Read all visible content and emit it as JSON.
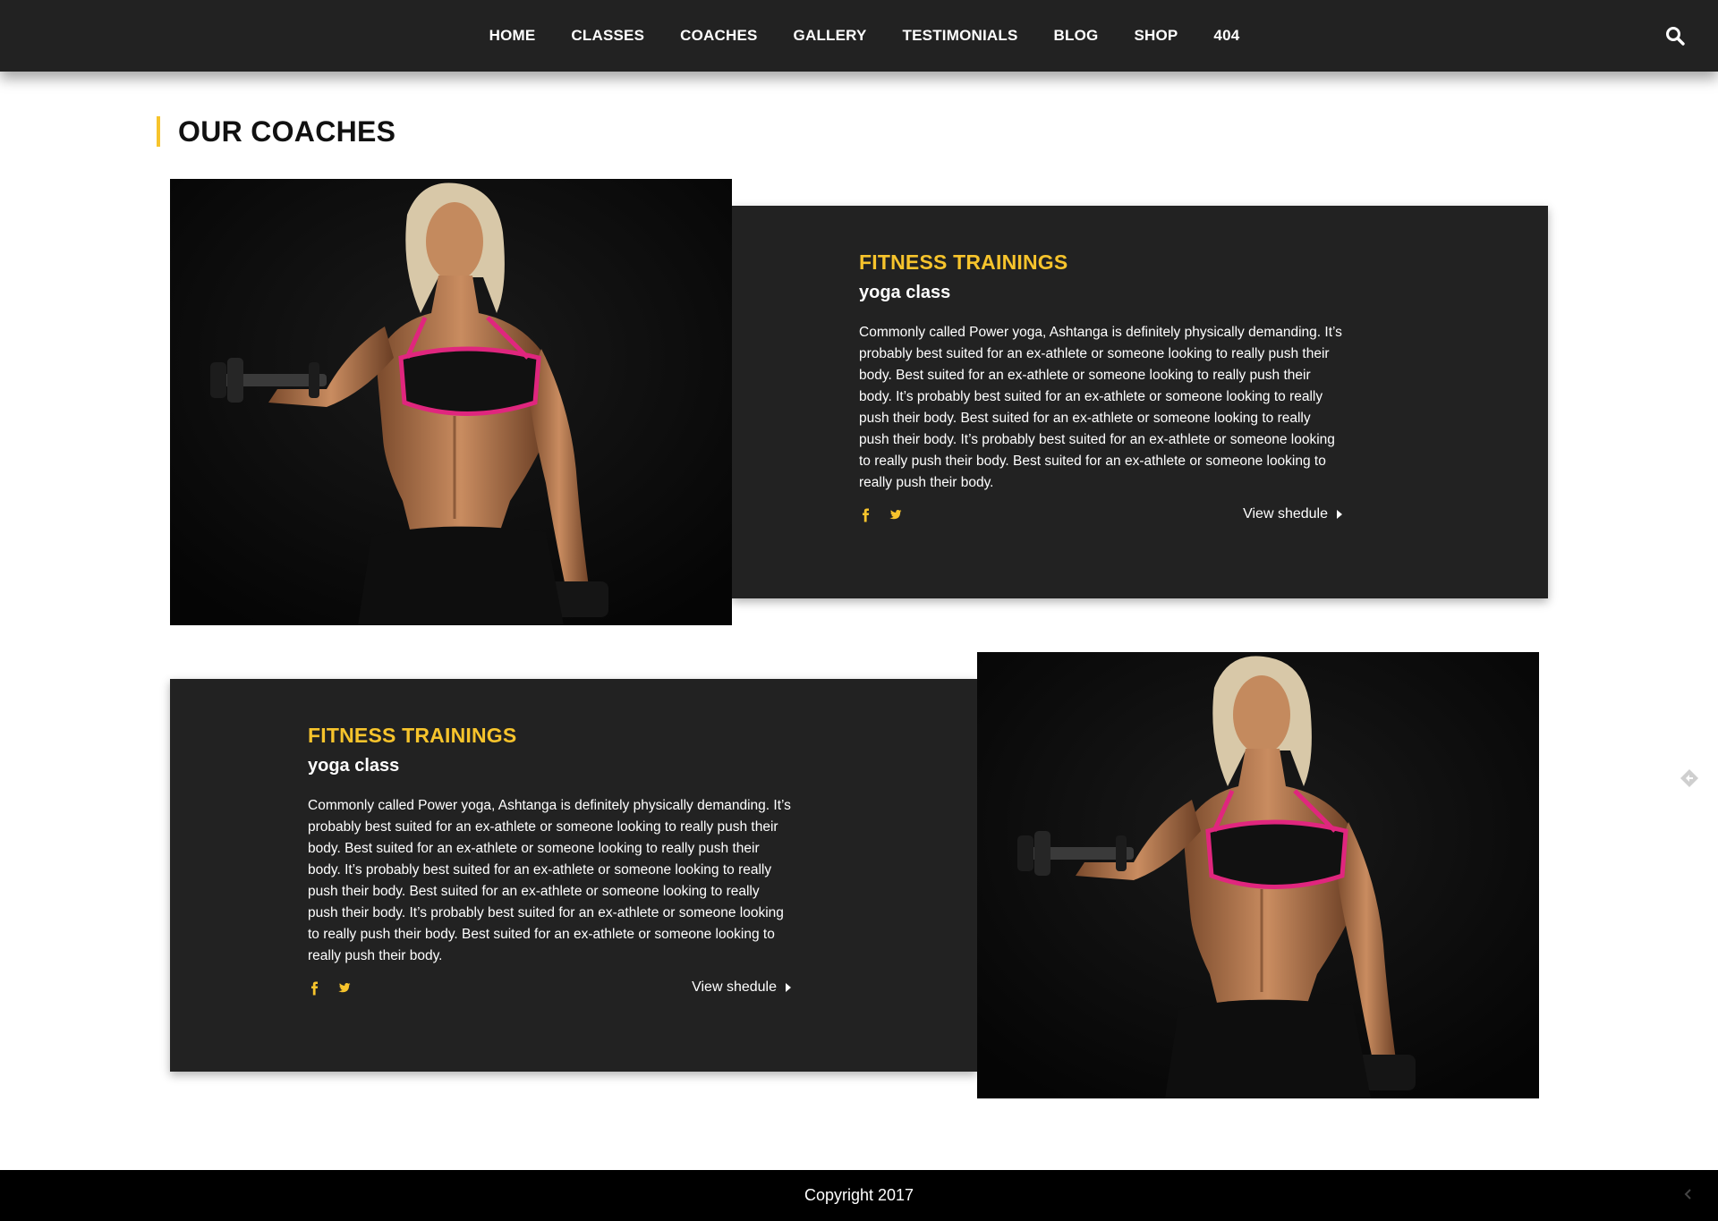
{
  "nav": {
    "items": [
      "HOME",
      "CLASSES",
      "COACHES",
      "GALLERY",
      "TESTIMONIALS",
      "BLOG",
      "SHOP",
      "404"
    ],
    "search_icon": "search-icon"
  },
  "section": {
    "title": "OUR COACHES"
  },
  "coaches": [
    {
      "title": "FITNESS TRAININGS",
      "subtitle": "yoga class",
      "description": "Commonly called Power yoga, Ashtanga is definitely physically demanding. It’s probably best suited for an ex-athlete or someone looking to really push their body. Best suited for an ex-athlete or someone looking to really push their body. It’s probably best suited for an ex-athlete or someone looking to really push their body. Best suited for an ex-athlete or someone looking to really push their body. It’s probably best suited for an ex-athlete or someone looking to really push their body. Best suited for an ex-athlete or someone looking to really push their body.",
      "schedule_label": "View shedule",
      "social": [
        "facebook-icon",
        "twitter-icon"
      ]
    },
    {
      "title": "FITNESS TRAININGS",
      "subtitle": "yoga class",
      "description": "Commonly called Power yoga, Ashtanga is definitely physically demanding. It’s probably best suited for an ex-athlete or someone looking to really push their body. Best suited for an ex-athlete or someone looking to really push their body. It’s probably best suited for an ex-athlete or someone looking to really push their body. Best suited for an ex-athlete or someone looking to really push their body. It’s probably best suited for an ex-athlete or someone looking to really push their body. Best suited for an ex-athlete or someone looking to really push their body.",
      "schedule_label": "View shedule",
      "social": [
        "facebook-icon",
        "twitter-icon"
      ]
    }
  ],
  "footer": {
    "copyright": "Copyright 2017"
  },
  "colors": {
    "accent": "#f7c42c",
    "dark": "#222222",
    "footer": "#000000",
    "bra_trim": "#e0267e"
  }
}
